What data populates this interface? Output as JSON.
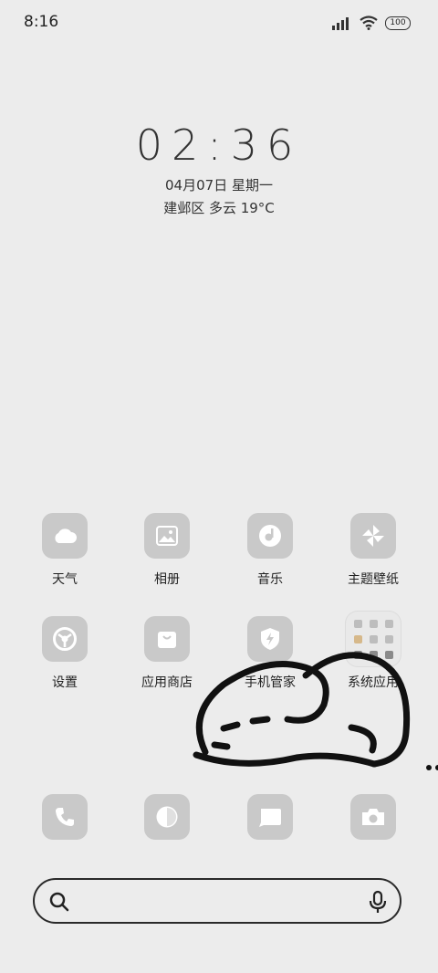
{
  "status_bar": {
    "time": "8:16",
    "battery": "100"
  },
  "clock": {
    "time": "02:36",
    "date": "04月07日 星期一",
    "weather": "建邺区 多云 19°C"
  },
  "apps_row1": [
    {
      "label": "天气",
      "icon": "cloud-icon"
    },
    {
      "label": "相册",
      "icon": "gallery-icon"
    },
    {
      "label": "音乐",
      "icon": "music-icon"
    },
    {
      "label": "主题壁纸",
      "icon": "pinwheel-icon"
    }
  ],
  "apps_row2": [
    {
      "label": "设置",
      "icon": "settings-icon"
    },
    {
      "label": "应用商店",
      "icon": "store-bag-icon"
    },
    {
      "label": "手机管家",
      "icon": "shield-icon"
    },
    {
      "label": "系统应用",
      "icon": "folder-icon"
    }
  ],
  "dock": [
    {
      "icon": "phone-icon"
    },
    {
      "icon": "browser-icon"
    },
    {
      "icon": "messages-icon"
    },
    {
      "icon": "camera-icon"
    }
  ],
  "search": {
    "placeholder": ""
  }
}
